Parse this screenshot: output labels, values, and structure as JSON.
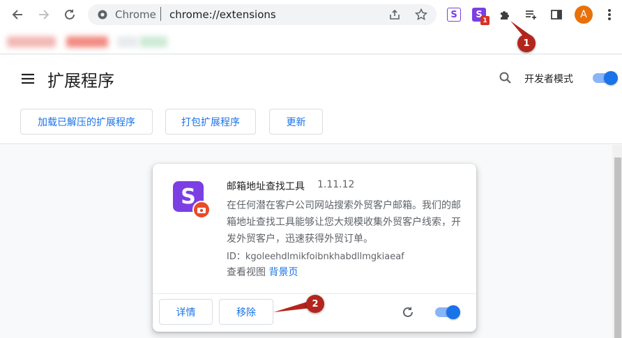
{
  "browser": {
    "omnibox_label": "Chrome",
    "url": "chrome://extensions",
    "profile_initial": "A",
    "ext_badge_count": "1"
  },
  "page": {
    "title": "扩展程序",
    "dev_mode_label": "开发者模式",
    "dev_mode_on": true,
    "buttons": {
      "load_unpacked": "加载已解压的扩展程序",
      "pack": "打包扩展程序",
      "update": "更新"
    }
  },
  "extension": {
    "name": "邮箱地址查找工具",
    "version": "1.11.12",
    "description": "在任何潜在客户公司网站搜索外贸客户邮箱。我们的邮箱地址查找工具能够让您大规模收集外贸客户线索，开发外贸客户，迅速获得外贸订单。",
    "id": "ID：kgoleehdlmikfoibnkhabdllmgkiaeaf",
    "views_label": "查看视图",
    "views_link": "背景页",
    "details_label": "详情",
    "remove_label": "移除",
    "enabled": true,
    "icon_letter": "S"
  },
  "annotations": {
    "one": "1",
    "two": "2"
  },
  "colors": {
    "accent": "#1a73e8",
    "annotation_red": "#b3261e",
    "ext_purple": "#7b3fe4",
    "profile_orange": "#e8710a"
  }
}
